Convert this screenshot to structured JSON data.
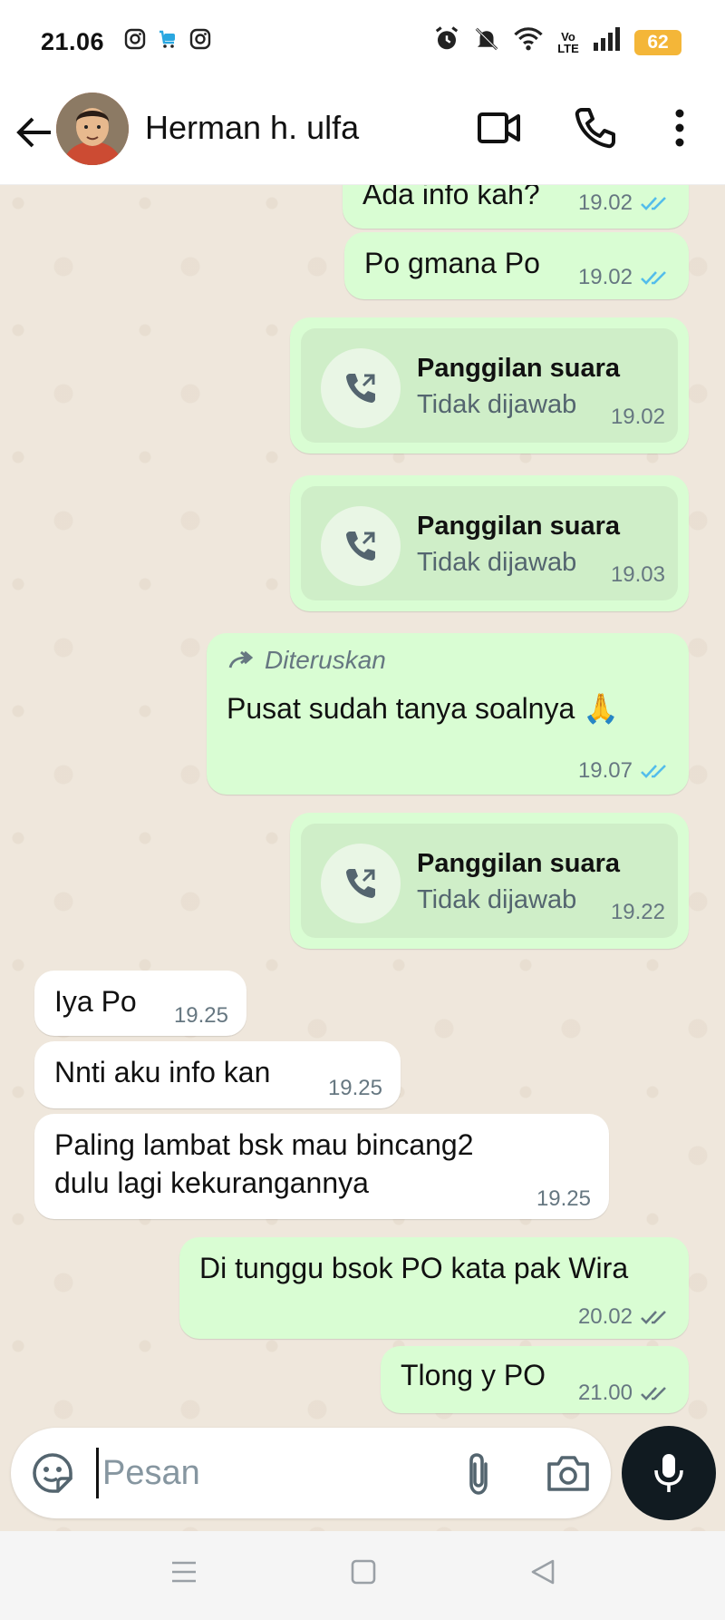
{
  "status_bar": {
    "time": "21.06",
    "battery": "62",
    "volte": "Vo LTE"
  },
  "header": {
    "contact_name": "Herman h. ulfa"
  },
  "messages": [
    {
      "dir": "out",
      "type": "text",
      "text": "Ada info kah?",
      "time": "19.02",
      "status": "read"
    },
    {
      "dir": "out",
      "type": "text",
      "text": "Po gmana Po",
      "time": "19.02",
      "status": "read"
    },
    {
      "dir": "out",
      "type": "call",
      "title": "Panggilan suara",
      "subtitle": "Tidak dijawab",
      "time": "19.02"
    },
    {
      "dir": "out",
      "type": "call",
      "title": "Panggilan suara",
      "subtitle": "Tidak dijawab",
      "time": "19.03"
    },
    {
      "dir": "out",
      "type": "forwarded",
      "forward_label": "Diteruskan",
      "text": "Pusat sudah tanya soalnya 🙏",
      "time": "19.07",
      "status": "read"
    },
    {
      "dir": "out",
      "type": "call",
      "title": "Panggilan suara",
      "subtitle": "Tidak dijawab",
      "time": "19.22"
    },
    {
      "dir": "in",
      "type": "text",
      "text": "Iya Po",
      "time": "19.25"
    },
    {
      "dir": "in",
      "type": "text",
      "text": "Nnti aku info kan",
      "time": "19.25"
    },
    {
      "dir": "in",
      "type": "text",
      "text_line1": "Paling lambat bsk mau bincang2",
      "text_line2": "dulu lagi kekurangannya",
      "time": "19.25"
    },
    {
      "dir": "out",
      "type": "text",
      "text": "Di tunggu bsok PO kata pak Wira",
      "time": "20.02",
      "status": "delivered"
    },
    {
      "dir": "out",
      "type": "text",
      "text": "Tlong y PO",
      "time": "21.00",
      "status": "delivered"
    }
  ],
  "input": {
    "placeholder": "Pesan"
  },
  "colors": {
    "outgoing_bubble": "#d9fdd3",
    "incoming_bubble": "#ffffff",
    "read_tick": "#53bdeb",
    "delivered_tick": "#667781",
    "chat_bg": "#efe7dc"
  },
  "icons": [
    "back-arrow-icon",
    "video-call-icon",
    "voice-call-icon",
    "more-options-icon",
    "missed-call-icon",
    "forward-icon",
    "sticker-icon",
    "attach-icon",
    "camera-icon",
    "mic-icon"
  ]
}
